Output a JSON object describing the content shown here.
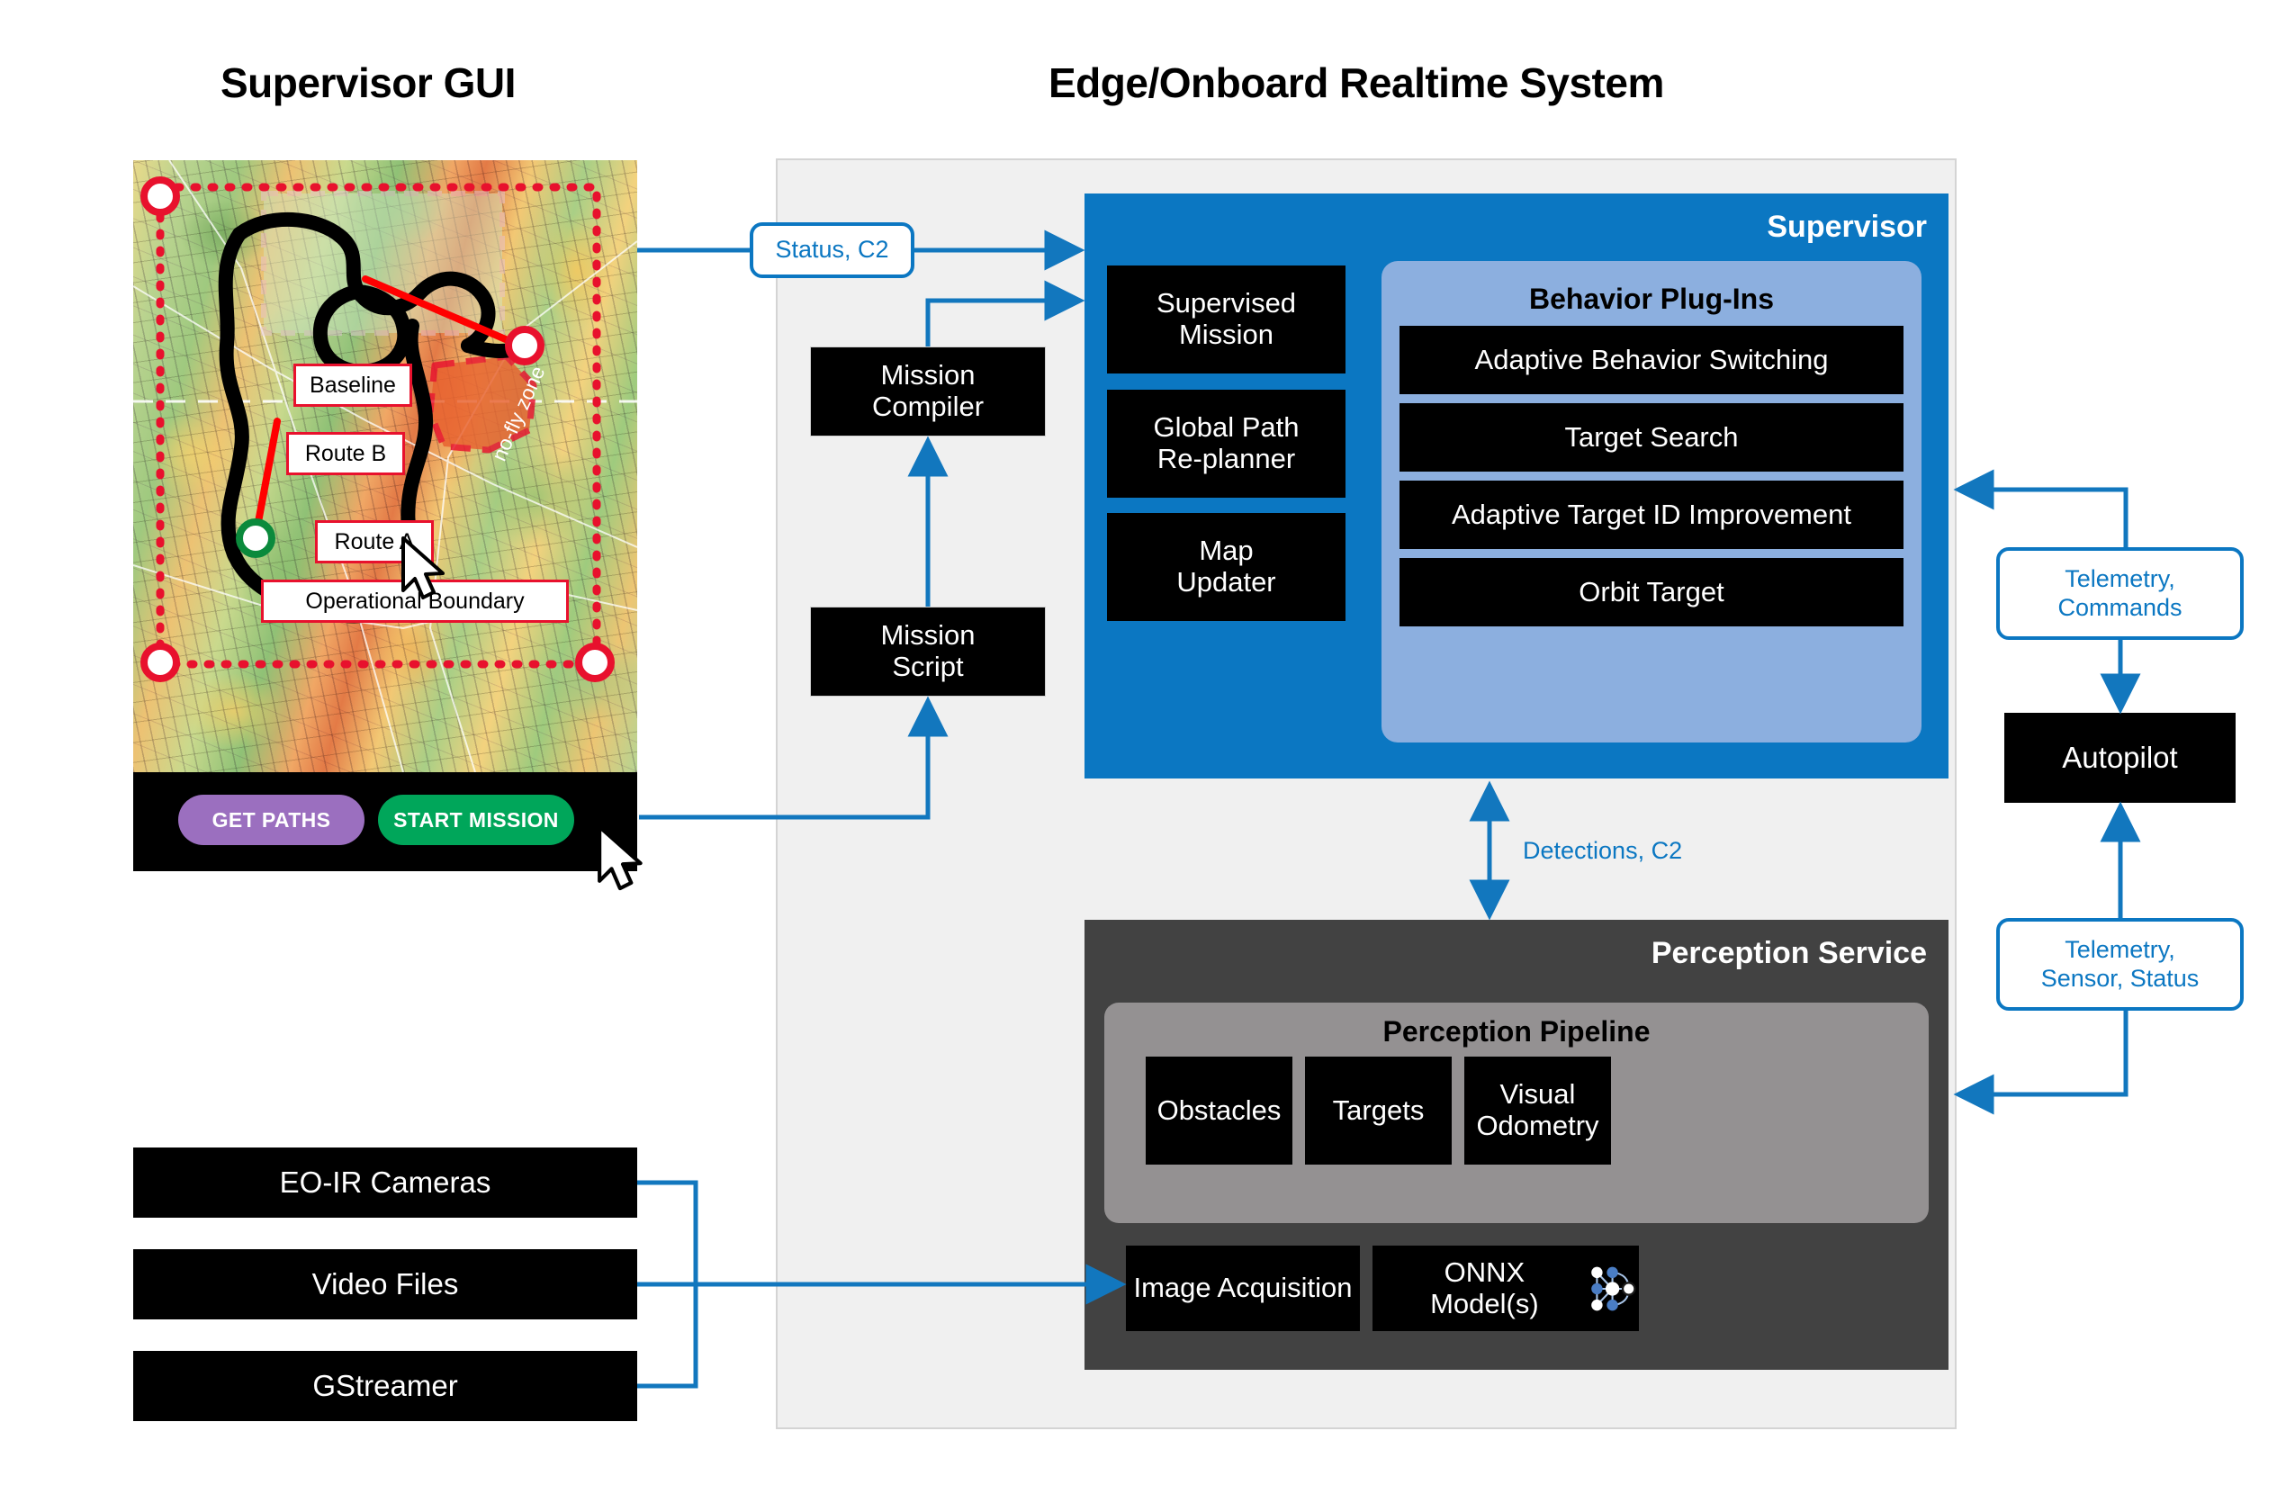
{
  "titles": {
    "left": "Supervisor GUI",
    "right": "Edge/Onboard Realtime System"
  },
  "gui": {
    "map_labels": {
      "baseline": "Baseline",
      "route_b": "Route B",
      "route_a": "Route A",
      "operational_boundary": "Operational Boundary",
      "no_fly_zone": "no-fly zone"
    },
    "buttons": {
      "get_paths": "GET PATHS",
      "start_mission": "START MISSION"
    },
    "colors": {
      "get_paths_bg": "#9b6fbf",
      "start_mission_bg": "#00a65a",
      "boundary": "#e8112d",
      "panel_bg": "#000000"
    }
  },
  "mission": {
    "compiler": "Mission\nCompiler",
    "compiler_line1": "Mission",
    "compiler_line2": "Compiler",
    "script_line1": "Mission",
    "script_line2": "Script"
  },
  "supervisor": {
    "title": "Supervisor",
    "color": "#0b77c2",
    "modules": [
      {
        "line1": "Supervised",
        "line2": "Mission"
      },
      {
        "line1": "Global Path",
        "line2": "Re-planner"
      },
      {
        "line1": "Map",
        "line2": "Updater"
      }
    ],
    "plugins_panel": {
      "title": "Behavior Plug-Ins",
      "color": "#8cafdf",
      "items": [
        "Adaptive Behavior Switching",
        "Target Search",
        "Adaptive Target ID Improvement",
        "Orbit Target"
      ]
    }
  },
  "perception": {
    "title": "Perception Service",
    "color": "#424242",
    "pipeline": {
      "title": "Perception Pipeline",
      "color": "#949192",
      "items": [
        {
          "line1": "Obstacles",
          "line2": ""
        },
        {
          "line1": "Targets",
          "line2": ""
        },
        {
          "line1": "Visual",
          "line2": "Odometry"
        }
      ]
    },
    "image_acquisition": "Image Acquisition",
    "onnx_models": "ONNX Model(s)",
    "onnx_icon": "onnx-network-icon"
  },
  "sources": [
    "EO-IR Cameras",
    "Video Files",
    "GStreamer"
  ],
  "autopilot": {
    "label": "Autopilot"
  },
  "flows": {
    "status_c2": "Status, C2",
    "detections_c2": "Detections, C2",
    "telemetry_commands_line1": "Telemetry,",
    "telemetry_commands_line2": "Commands",
    "telemetry_sensor_line1": "Telemetry,",
    "telemetry_sensor_line2": "Sensor, Status",
    "accent": "#0b77c2"
  }
}
